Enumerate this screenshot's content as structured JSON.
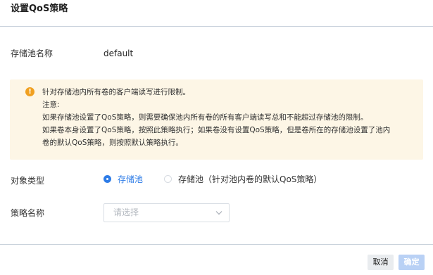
{
  "dialog": {
    "title": "设置QoS策略"
  },
  "pool": {
    "label": "存储池名称",
    "value": "default"
  },
  "notice": {
    "icon": "warning-icon",
    "lines": [
      "针对存储池内所有卷的客户端读写进行限制。",
      "注意:",
      "如果存储池设置了QoS策略，则需要确保池内所有卷的所有客户端读写总和不能超过存储池的限制。",
      "如果卷本身设置了QoS策略，按照此策略执行；如果卷没有设置QoS策略，但是卷所在的存储池设置了池内",
      "卷的默认QoS策略，则按照默认策略执行。"
    ]
  },
  "object_type": {
    "label": "对象类型",
    "options": [
      {
        "label": "存储池",
        "selected": true
      },
      {
        "label": "存储池（针对池内卷的默认QoS策略）",
        "selected": false
      }
    ]
  },
  "policy": {
    "label": "策略名称",
    "placeholder": "请选择"
  },
  "footer": {
    "cancel_label": "取消",
    "ok_label": "确定"
  },
  "colors": {
    "accent": "#2e7ce7",
    "warning": "#f0a020",
    "notice_bg": "#fdf6e6"
  }
}
